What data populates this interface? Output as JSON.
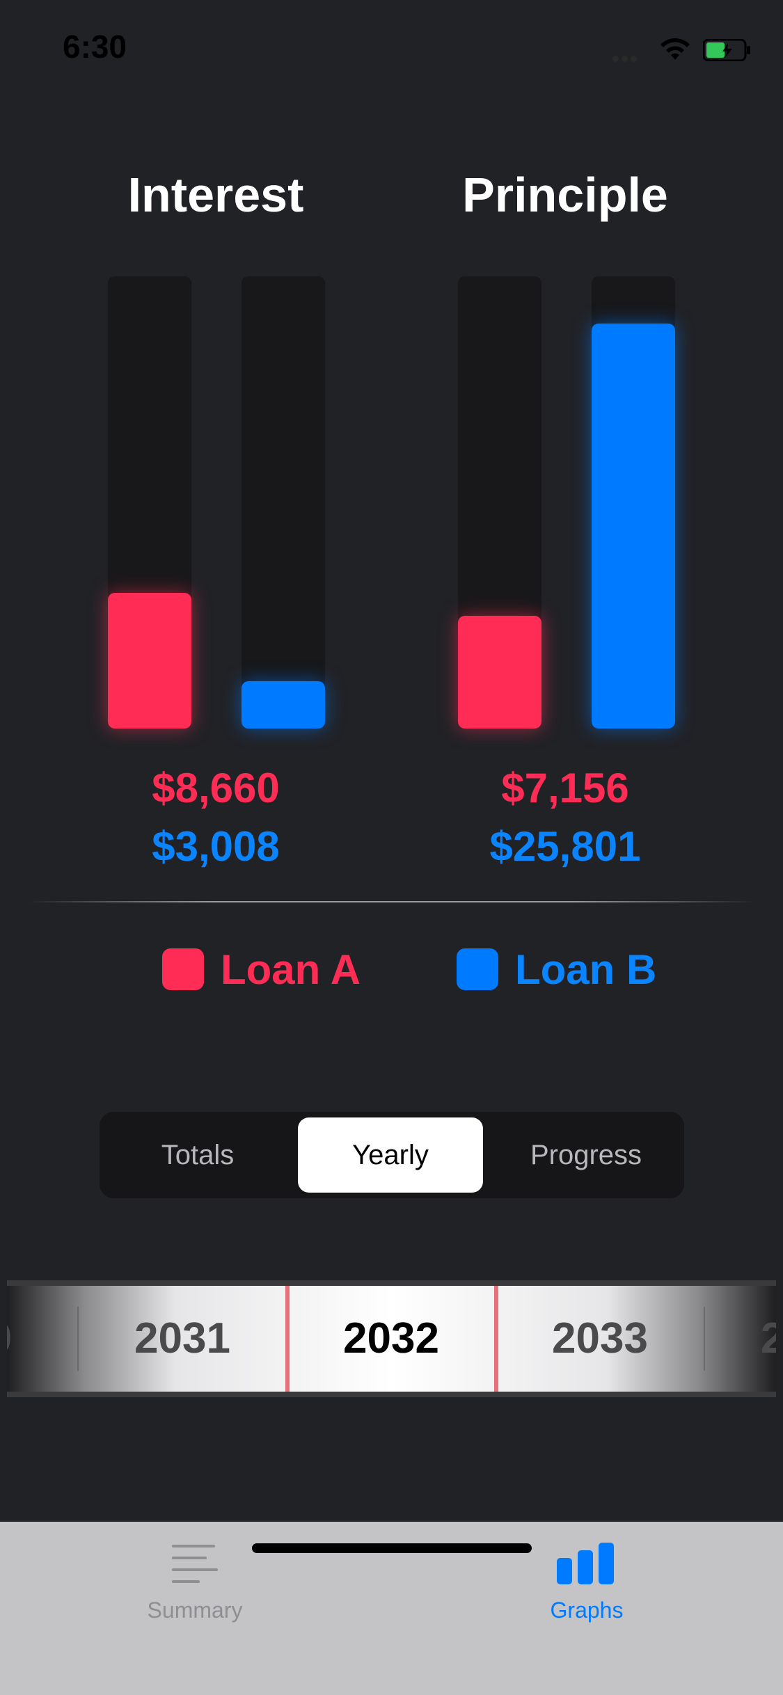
{
  "status_bar": {
    "time": "6:30"
  },
  "charts": [
    {
      "title": "Interest",
      "bars": [
        {
          "series": "Loan A",
          "fraction": 0.3
        },
        {
          "series": "Loan B",
          "fraction": 0.105
        }
      ],
      "values": [
        "$8,660",
        "$3,008"
      ]
    },
    {
      "title": "Principle",
      "bars": [
        {
          "series": "Loan A",
          "fraction": 0.25
        },
        {
          "series": "Loan B",
          "fraction": 0.895
        }
      ],
      "values": [
        "$7,156",
        "$25,801"
      ]
    }
  ],
  "legend": [
    {
      "label": "Loan A",
      "color": "#ff2d55"
    },
    {
      "label": "Loan B",
      "color": "#007aff"
    }
  ],
  "segmented_control": {
    "options": [
      "Totals",
      "Yearly",
      "Progress"
    ],
    "selected": "Yearly"
  },
  "year_picker": {
    "items": [
      "0",
      "2031",
      "2032",
      "2033",
      "2"
    ],
    "selected": "2032"
  },
  "tab_bar": {
    "tabs": [
      {
        "label": "Summary",
        "icon": "list-icon",
        "active": false
      },
      {
        "label": "Graphs",
        "icon": "bar-chart-icon",
        "active": true
      }
    ]
  },
  "colors": {
    "loan_a": "#ff2d55",
    "loan_b": "#007aff",
    "tab_active": "#007aff",
    "tab_inactive": "#8e8e93"
  }
}
